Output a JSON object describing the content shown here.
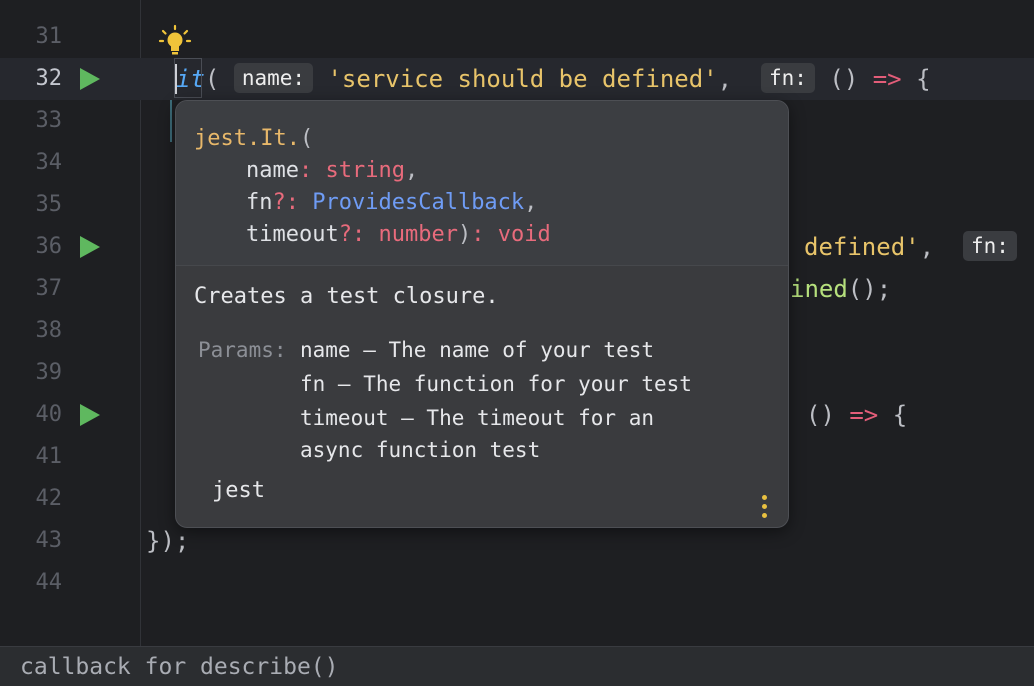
{
  "editor": {
    "line_numbers": [
      "31",
      "32",
      "33",
      "34",
      "35",
      "36",
      "37",
      "38",
      "39",
      "40",
      "41",
      "42",
      "43",
      "44"
    ],
    "line32": {
      "it": "it",
      "paren": "(",
      "hint_name": "name:",
      "string": "'service should be defined'",
      "comma": ",",
      "hint_fn": "fn:",
      "parens": "()",
      "arrow": "=>",
      "brace": "{"
    },
    "line36": {
      "string_tail": "defined'",
      "comma": ",",
      "hint_fn": "fn:",
      "paren": "()"
    },
    "line37": {
      "method_tail": "ined",
      "tail": "();"
    },
    "line40": {
      "parens": "()",
      "arrow": "=>",
      "brace": "{"
    },
    "line43": "});"
  },
  "popup": {
    "signature": {
      "fn_name": "jest.It.",
      "open_paren": "(",
      "p1_name": "name",
      "p1_type": "string",
      "p2_name": "fn",
      "p2_type": "ProvidesCallback",
      "p3_name": "timeout",
      "p3_type": "number",
      "return_type": "void"
    },
    "description": "Creates a test closure.",
    "params_label": "Params:",
    "params": [
      "name – The name of your test",
      "fn – The function for your test",
      "timeout – The timeout for an",
      "async function test"
    ],
    "module": "jest"
  },
  "statusbar": {
    "text": "callback for describe()"
  },
  "colors": {
    "run_icon": "#5fb85f",
    "string": "#e8c46a",
    "arrow": "#e35d79",
    "type": "#e86b7c",
    "class": "#6f9cf5"
  }
}
